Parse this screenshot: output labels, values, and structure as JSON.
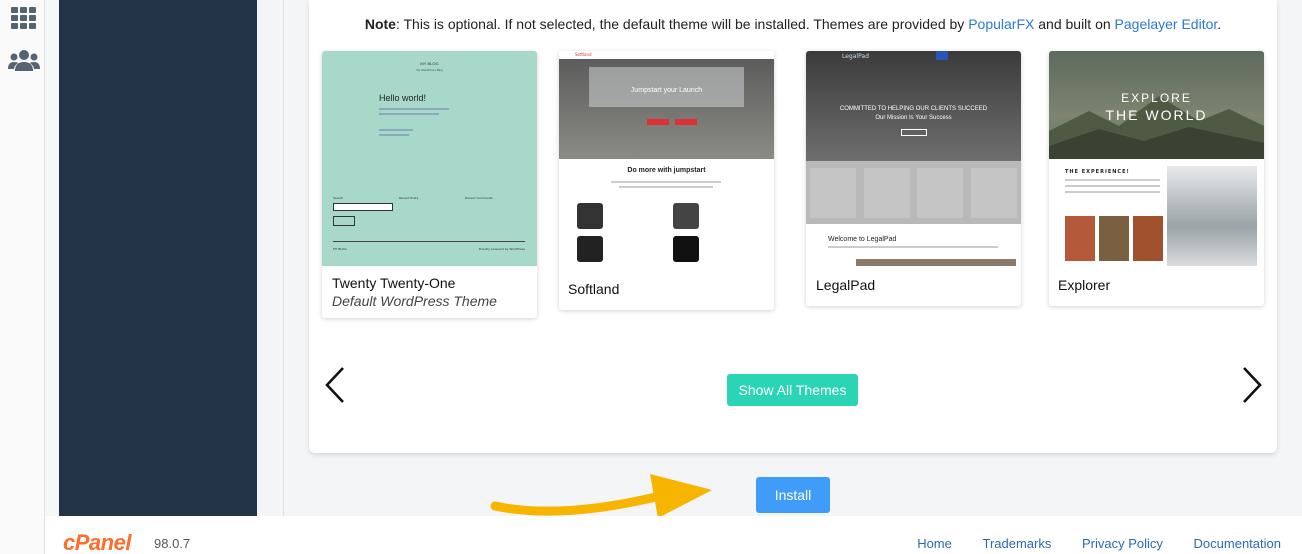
{
  "note": {
    "label": "Note",
    "text1": ": This is optional. If not selected, the default theme will be installed. Themes are provided by ",
    "link1": "PopularFX",
    "text2": " and built on ",
    "link2": "Pagelayer Editor",
    "text3": "."
  },
  "themes": [
    {
      "name": "Twenty Twenty-One",
      "subtitle": "Default WordPress Theme",
      "preview": {
        "blog_title": "MY BLOG",
        "blog_tagline": "My WordPress Blog",
        "heading": "Hello world!",
        "search": "Search",
        "recent_posts": "Recent Posts",
        "recent_comments": "Recent Comments",
        "footer_left": "MY BLOG",
        "footer_right": "Proudly powered by WordPress"
      }
    },
    {
      "name": "Softland",
      "preview": {
        "brand": "Softland",
        "hero": "Jumpstart your Launch",
        "section": "Do more with jumpstart"
      }
    },
    {
      "name": "LegalPad",
      "preview": {
        "brand": "LegalPad",
        "hero1": "COMMITTED TO HELPING OUR CLIENTS SUCCEED",
        "hero2": "Our Mission Is Your Success",
        "welcome": "Welcome to LegalPad"
      }
    },
    {
      "name": "Explorer",
      "preview": {
        "line1": "EXPLORE",
        "line2": "THE WORLD",
        "section": "THE EXPERIENCE!"
      }
    }
  ],
  "buttons": {
    "show_all": "Show All Themes",
    "install": "Install"
  },
  "footer": {
    "logo": "cPanel",
    "version": "98.0.7",
    "links": [
      "Home",
      "Trademarks",
      "Privacy Policy",
      "Documentation"
    ]
  },
  "colors": {
    "accent_teal": "#2bd4b4",
    "install_blue": "#3f9cf8",
    "arrow_yellow": "#f7b500",
    "sidebar_dark": "#243447",
    "cpanel_orange": "#ff6c2c"
  }
}
